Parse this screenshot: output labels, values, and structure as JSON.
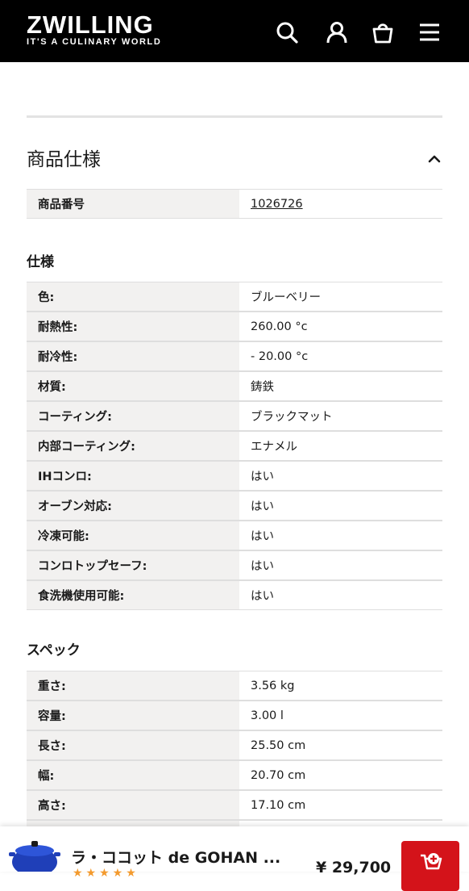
{
  "header": {
    "logo_main": "ZWILLING",
    "logo_sub": "IT'S A CULINARY WORLD",
    "icons": [
      "search-icon",
      "user-icon",
      "shopping-bag-icon",
      "menu-icon"
    ],
    "background": "#000000"
  },
  "specs_section": {
    "title": "商品仕様",
    "item_number": {
      "label": "商品番号",
      "value": "1026726"
    },
    "spec_group": {
      "title": "仕様",
      "rows": [
        {
          "label": "色:",
          "value": "ブルーベリー"
        },
        {
          "label": "耐熱性:",
          "value": "260.00 °c"
        },
        {
          "label": "耐冷性:",
          "value": "- 20.00 °c"
        },
        {
          "label": "材質:",
          "value": "鋳鉄"
        },
        {
          "label": "コーティング:",
          "value": "ブラックマット"
        },
        {
          "label": "内部コーティング:",
          "value": "エナメル"
        },
        {
          "label": "IHコンロ:",
          "value": "はい"
        },
        {
          "label": "オーブン対応:",
          "value": "はい"
        },
        {
          "label": "冷凍可能:",
          "value": "はい"
        },
        {
          "label": "コンロトップセーフ:",
          "value": "はい"
        },
        {
          "label": "食洗機使用可能:",
          "value": "はい"
        }
      ]
    },
    "measure_group": {
      "title": "スペック",
      "rows": [
        {
          "label": "重さ:",
          "value": "3.56 kg"
        },
        {
          "label": "容量:",
          "value": "3.00 l"
        },
        {
          "label": "長さ:",
          "value": "25.50 cm"
        },
        {
          "label": "幅:",
          "value": "20.70 cm"
        },
        {
          "label": "高さ:",
          "value": "17.10 cm"
        }
      ]
    }
  },
  "bottom_bar": {
    "product_name": "ラ・ココット de GOHAN ...",
    "price": "¥ 29,700",
    "rating_stars": "★★★★★",
    "accent": "#d4131a",
    "product_color": "#1f3fb8"
  }
}
